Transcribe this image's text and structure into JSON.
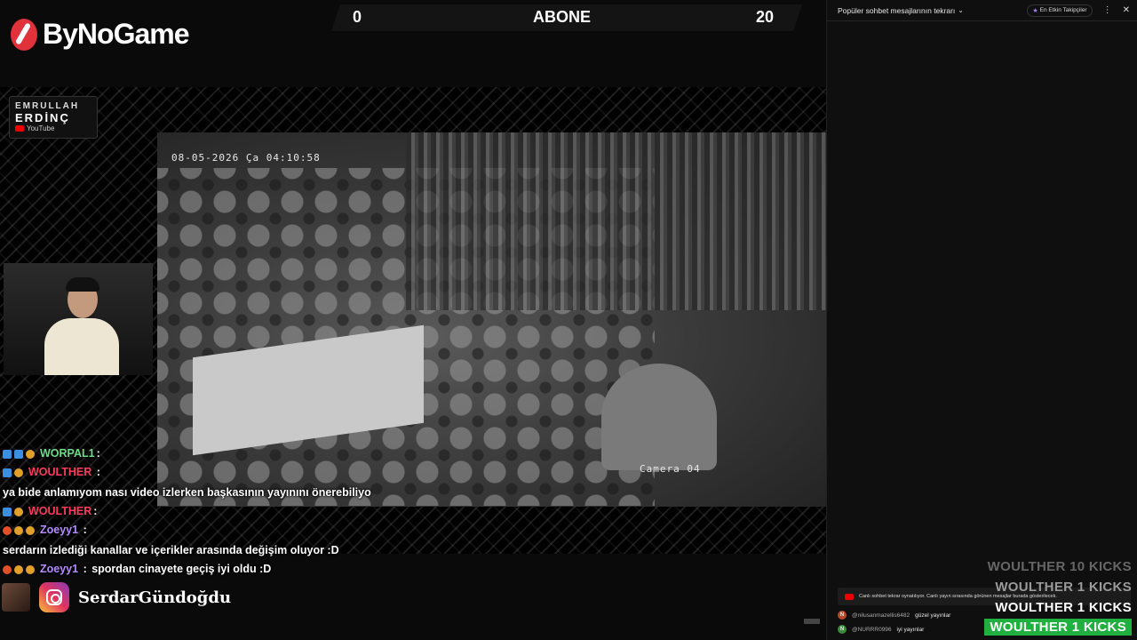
{
  "brand": {
    "name": "ByNoGame"
  },
  "scoreboard": {
    "left": "0",
    "title": "ABONE",
    "right": "20"
  },
  "channel_logo": {
    "line1": "EMRULLAH",
    "line2": "ERDİNÇ",
    "line3": "YouTube"
  },
  "video": {
    "timestamp": "08-05-2026 Ça 04:10:58",
    "camera": "Camera 04"
  },
  "overlay_chat": [
    {
      "user": "WORPAL1",
      "text": "",
      "color": "#6edc8a"
    },
    {
      "user": "WOULTHER",
      "text": "ya bide anlamıyom nası video izlerken başkasının yayınını önerebiliyo",
      "color": "#ff3b5c"
    },
    {
      "user": "WOULTHER",
      "text": "",
      "color": "#ff3b5c"
    },
    {
      "user": "Zoeyy1",
      "text": "serdarın izlediği kanallar ve içerikler arasında değişim oluyor :D",
      "color": "#b58cff"
    },
    {
      "user": "Zoeyy1",
      "text": "spordan cinayete geçiş iyi oldu :D",
      "color": "#b58cff"
    }
  ],
  "social": {
    "handle": "SerdarGündoğdu",
    "icon": "instagram-icon"
  },
  "chat_panel": {
    "title": "Popüler sohbet mesajlarının tekrarı",
    "top_fans": "En Etkin Takipçiler",
    "replay_notice": "Canlı sohbet tekrar oynatılıyor. Canlı yayın sırasında görünen mesajlar burada gösterilecek.",
    "messages": [
      {
        "initial": "N",
        "author": "@nilusanmazellis6482",
        "text": "güzel yayınlar"
      },
      {
        "initial": "N",
        "author": "@NURRR0996",
        "text": "iyi yayınlar"
      }
    ]
  },
  "kicks": [
    "WOULTHER  10 KICKS",
    "WOULTHER  1 KICKS",
    "WOULTHER  1 KICKS",
    "WOULTHER  1 KICKS"
  ],
  "colors": {
    "accent_red": "#e0323a",
    "kick_green": "#1fb040"
  }
}
